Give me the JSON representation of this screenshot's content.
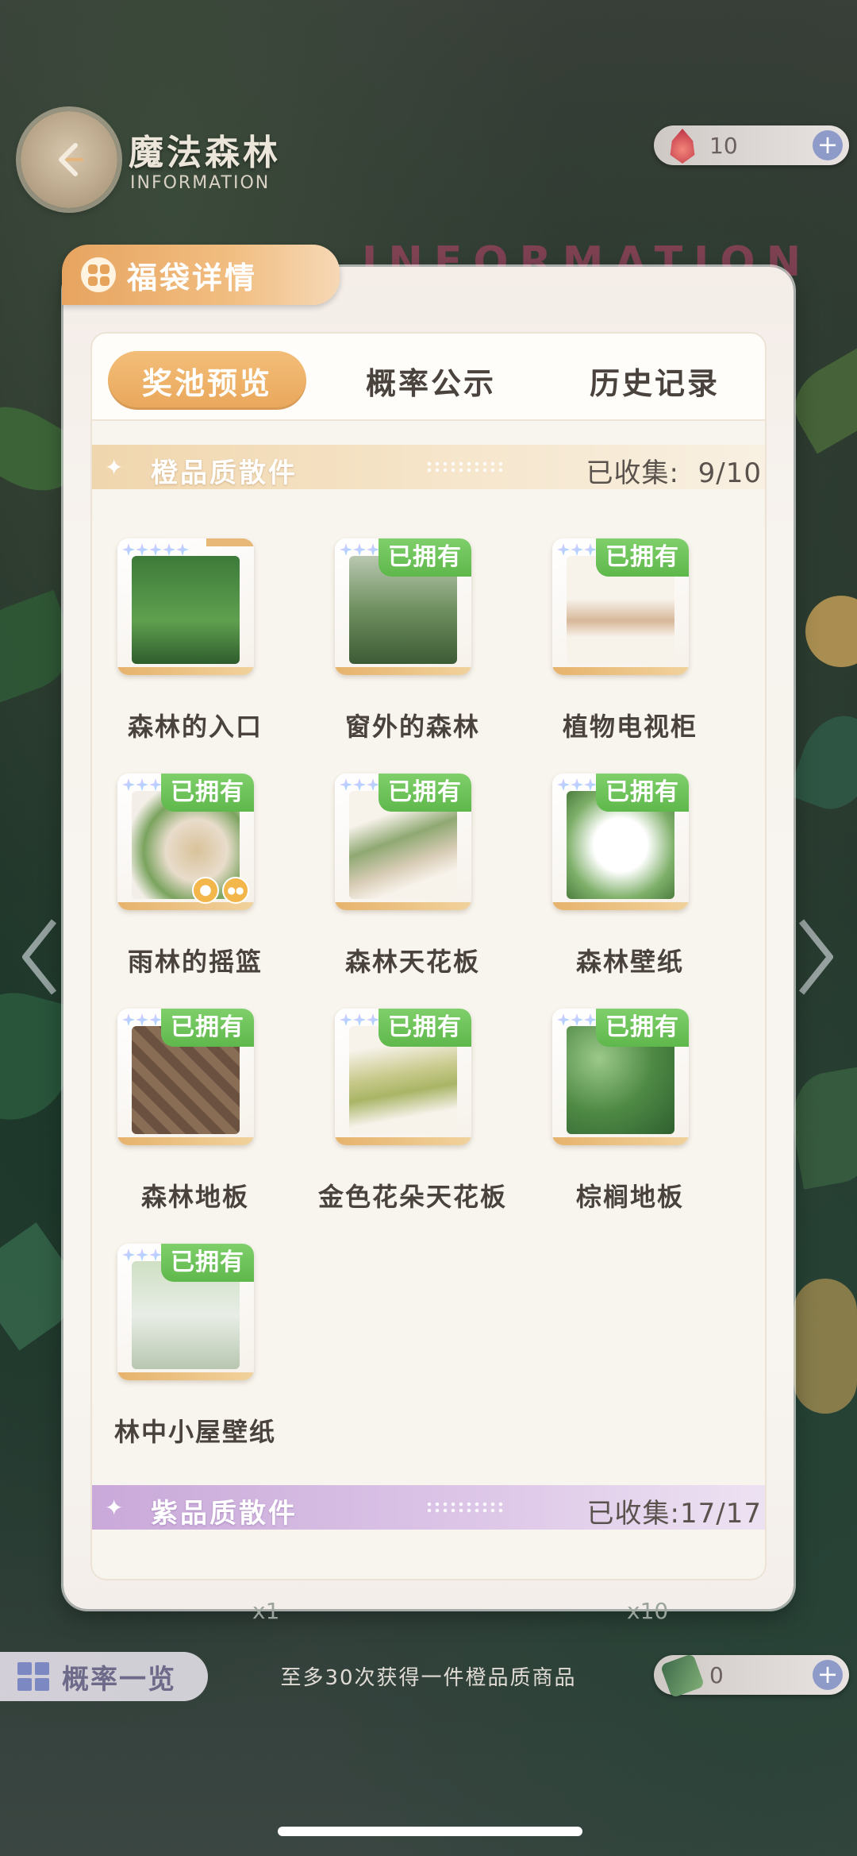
{
  "header": {
    "title": "魔法森林",
    "subtitle": "INFORMATION",
    "watermark": "INFORMATION"
  },
  "currency": {
    "top_value": "10",
    "bottom_value": "0",
    "plus": "+"
  },
  "panel": {
    "title": "福袋详情",
    "tabs": [
      {
        "label": "奖池预览",
        "active": true
      },
      {
        "label": "概率公示",
        "active": false
      },
      {
        "label": "历史记录",
        "active": false
      }
    ]
  },
  "sections": {
    "orange": {
      "title": "橙品质散件",
      "count_label": "已收集:",
      "count": "9/10",
      "items": [
        {
          "name": "森林的入口",
          "owned": false,
          "icon": "forest-entrance-icon"
        },
        {
          "name": "窗外的森林",
          "owned": true,
          "icon": "window-forest-icon"
        },
        {
          "name": "植物电视柜",
          "owned": true,
          "icon": "plant-tv-cabinet-icon"
        },
        {
          "name": "雨林的摇篮",
          "owned": true,
          "icon": "rainforest-cradle-icon"
        },
        {
          "name": "森林天花板",
          "owned": true,
          "icon": "forest-ceiling-icon"
        },
        {
          "name": "森林壁纸",
          "owned": true,
          "icon": "forest-wallpaper-icon"
        },
        {
          "name": "森林地板",
          "owned": true,
          "icon": "forest-floor-icon"
        },
        {
          "name": "金色花朵天花板",
          "owned": true,
          "icon": "golden-flower-ceiling-icon"
        },
        {
          "name": "棕榈地板",
          "owned": true,
          "icon": "palm-floor-icon"
        },
        {
          "name": "林中小屋壁纸",
          "owned": true,
          "icon": "cabin-wallpaper-icon"
        }
      ]
    },
    "purple": {
      "title": "紫品质散件",
      "count_label": "已收集:",
      "count": "17/17"
    }
  },
  "owned_badge": "已拥有",
  "bottom": {
    "probability_button": "概率一览",
    "hint": "至多30次获得一件橙品质商品",
    "x1": "x1",
    "x10": "x10"
  },
  "colors": {
    "accent_orange": "#e9a75b",
    "owned_green": "#5fb84c",
    "purple_bar": "#c9a9d9"
  }
}
